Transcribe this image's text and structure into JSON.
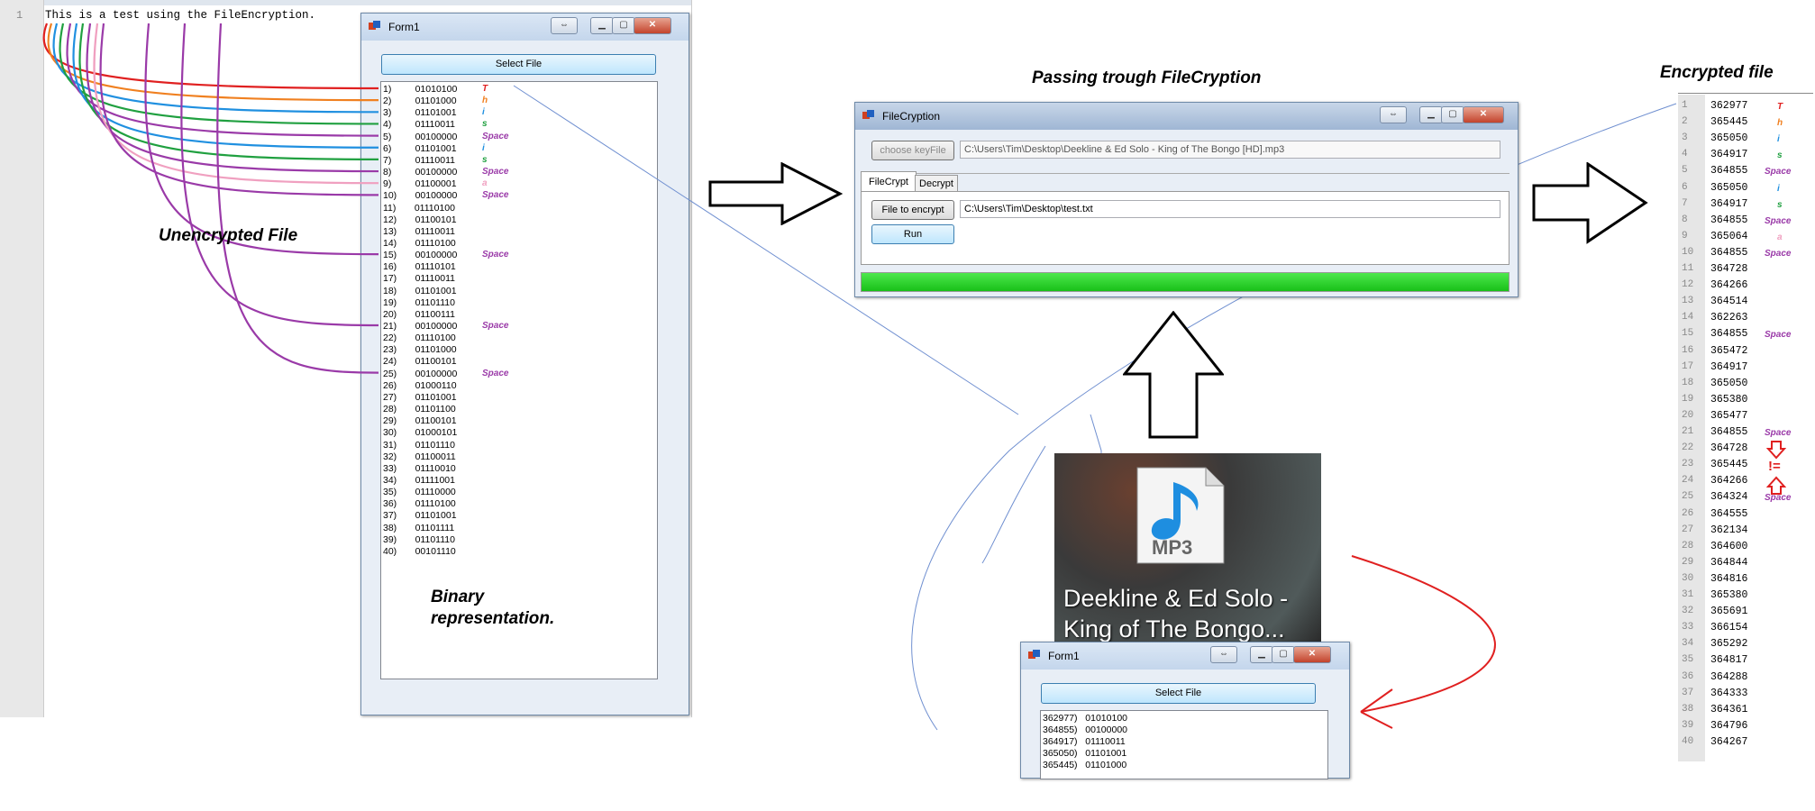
{
  "editor": {
    "line_no": "1",
    "text": "This is a test using the FileEncryption."
  },
  "labels": {
    "unencrypted": "Unencrypted File",
    "binary_line1": "Binary",
    "binary_line2": "representation.",
    "passing": "Passing trough FileCryption",
    "encrypted": "Encrypted file"
  },
  "form1_large": {
    "title": "Form1",
    "select_btn": "Select File",
    "rows": [
      "1)         01010100",
      "2)         01101000",
      "3)         01101001",
      "4)         01110011",
      "5)         00100000",
      "6)         01101001",
      "7)         01110011",
      "8)         00100000",
      "9)         01100001",
      "10)       00100000",
      "11)       01110100",
      "12)       01100101",
      "13)       01110011",
      "14)       01110100",
      "15)       00100000",
      "16)       01110101",
      "17)       01110011",
      "18)       01101001",
      "19)       01101110",
      "20)       01100111",
      "21)       00100000",
      "22)       01110100",
      "23)       01101000",
      "24)       01100101",
      "25)       00100000",
      "26)       01000110",
      "27)       01101001",
      "28)       01101100",
      "29)       01100101",
      "30)       01000101",
      "31)       01101110",
      "32)       01100011",
      "33)       01110010",
      "34)       01111001",
      "35)       01110000",
      "36)       01110100",
      "37)       01101001",
      "38)       01101111",
      "39)       01101110",
      "40)       00101110"
    ],
    "char_labels": [
      {
        "row": 0,
        "text": "T",
        "color": "#e02020"
      },
      {
        "row": 1,
        "text": "h",
        "color": "#f08020"
      },
      {
        "row": 2,
        "text": "i",
        "color": "#2090e0"
      },
      {
        "row": 3,
        "text": "s",
        "color": "#20a040"
      },
      {
        "row": 4,
        "text": "Space",
        "color": "#9a3aa8"
      },
      {
        "row": 5,
        "text": "i",
        "color": "#2090e0"
      },
      {
        "row": 6,
        "text": "s",
        "color": "#20a040"
      },
      {
        "row": 7,
        "text": "Space",
        "color": "#9a3aa8"
      },
      {
        "row": 8,
        "text": "a",
        "color": "#f0a0c0"
      },
      {
        "row": 9,
        "text": "Space",
        "color": "#9a3aa8"
      },
      {
        "row": 14,
        "text": "Space",
        "color": "#9a3aa8"
      },
      {
        "row": 20,
        "text": "Space",
        "color": "#9a3aa8"
      },
      {
        "row": 24,
        "text": "Space",
        "color": "#9a3aa8"
      }
    ]
  },
  "filecryption": {
    "title": "FileCryption",
    "choose_key_btn": "choose keyFile",
    "key_path": "C:\\Users\\Tim\\Desktop\\Deekline & Ed Solo - King of The Bongo [HD].mp3",
    "tabs": [
      "FileCrypt",
      "Decrypt"
    ],
    "file_btn": "File to encrypt",
    "file_path": "C:\\Users\\Tim\\Desktop\\test.txt",
    "run_btn": "Run",
    "progress": 1.0
  },
  "mp3_icon": {
    "badge": "MP3",
    "caption": "Deekline & Ed Solo - King of The Bongo..."
  },
  "form1_small": {
    "title": "Form1",
    "select_btn": "Select File",
    "rows": [
      "362977)   01010100",
      "364855)   00100000",
      "364917)   01110011",
      "365050)   01101001",
      "365445)   01101000"
    ]
  },
  "encrypted": {
    "values": [
      "362977",
      "365445",
      "365050",
      "364917",
      "364855",
      "365050",
      "364917",
      "364855",
      "365064",
      "364855",
      "364728",
      "364266",
      "364514",
      "362263",
      "364855",
      "365472",
      "364917",
      "365050",
      "365380",
      "365477",
      "364855",
      "364728",
      "365445",
      "364266",
      "364324",
      "364555",
      "362134",
      "364600",
      "364844",
      "364816",
      "365380",
      "365691",
      "366154",
      "365292",
      "364817",
      "364288",
      "364333",
      "364361",
      "364796",
      "364267"
    ],
    "char_labels": [
      {
        "row": 0,
        "text": "T",
        "color": "#e02020"
      },
      {
        "row": 1,
        "text": "h",
        "color": "#f08020"
      },
      {
        "row": 2,
        "text": "i",
        "color": "#2090e0"
      },
      {
        "row": 3,
        "text": "s",
        "color": "#20a040"
      },
      {
        "row": 4,
        "text": "Space",
        "color": "#9a3aa8"
      },
      {
        "row": 5,
        "text": "i",
        "color": "#2090e0"
      },
      {
        "row": 6,
        "text": "s",
        "color": "#20a040"
      },
      {
        "row": 7,
        "text": "Space",
        "color": "#9a3aa8"
      },
      {
        "row": 8,
        "text": "a",
        "color": "#f0a0c0"
      },
      {
        "row": 9,
        "text": "Space",
        "color": "#9a3aa8"
      },
      {
        "row": 14,
        "text": "Space",
        "color": "#9a3aa8"
      },
      {
        "row": 20,
        "text": "Space",
        "color": "#9a3aa8"
      },
      {
        "row": 24,
        "text": "Space",
        "color": "#9a3aa8"
      }
    ],
    "neq": "!="
  }
}
